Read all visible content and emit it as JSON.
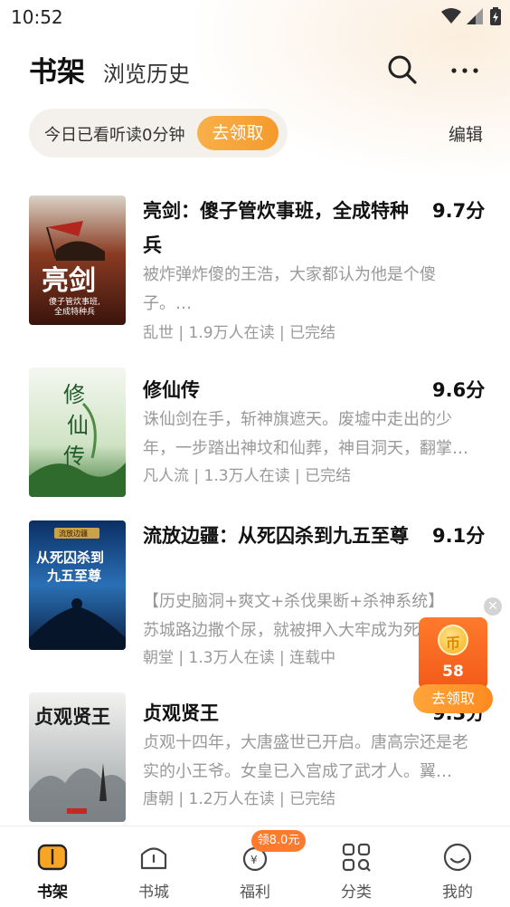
{
  "status_bar": {
    "time": "10:52"
  },
  "header": {
    "tab_shelf": "书架",
    "tab_history": "浏览历史"
  },
  "reading_banner": {
    "text": "今日已看听读0分钟",
    "claim_label": "去领取",
    "edit_label": "编辑"
  },
  "books": [
    {
      "title": "亮剑：傻子管炊事班，全成特种兵",
      "score": "9.7分",
      "desc": "被炸弹炸傻的王浩，大家都认为他是个傻子。…",
      "meta": "乱世 | 1.9万人在读 | 已完结",
      "cover_text": "亮剑",
      "cover_sub": "傻子管炊事班,\n全成特种兵"
    },
    {
      "title": "修仙传",
      "score": "9.6分",
      "desc": "诛仙剑在手，斩神旗遮天。废墟中走出的少年，一步踏出神坟和仙葬，神目洞天，翻掌…",
      "meta": "凡人流 | 1.3万人在读 | 已完结",
      "cover_text": "修仙传"
    },
    {
      "title": "流放边疆：从死囚杀到九五至尊",
      "score": "9.1分",
      "tags": "【历史脑洞+爽文+杀伐果断+杀神系统】",
      "desc": "苏城路边撒个尿，就被押入大牢成为死囚",
      "meta": "朝堂 | 1.3万人在读 | 连载中",
      "cover_text": "从死囚杀到九五至尊",
      "cover_top": "流放边疆"
    },
    {
      "title": "贞观贤王",
      "score": "9.3分",
      "desc": "贞观十四年，大唐盛世已开启。唐高宗还是老实的小王爷。女皇已入宫成了武才人。翼…",
      "meta": "唐朝 | 1.2万人在读 | 已完结",
      "cover_text": "贞观贤王"
    }
  ],
  "reward_float": {
    "count": "58",
    "claim_label": "去领取"
  },
  "bottom_nav": {
    "badge": "领8.0元",
    "items": [
      {
        "label": "书架",
        "icon": "bookshelf-icon"
      },
      {
        "label": "书城",
        "icon": "bookstore-icon"
      },
      {
        "label": "福利",
        "icon": "welfare-icon"
      },
      {
        "label": "分类",
        "icon": "category-icon"
      },
      {
        "label": "我的",
        "icon": "profile-icon"
      }
    ]
  }
}
